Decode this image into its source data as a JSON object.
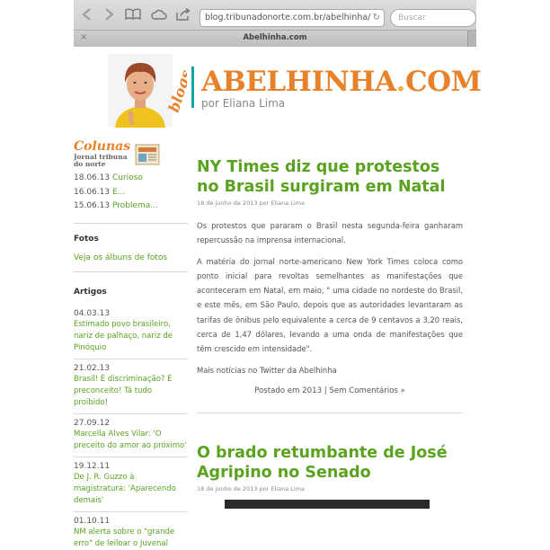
{
  "browser": {
    "url": "blog.tribunadonorte.com.br/abelhinha/",
    "search_placeholder": "Buscar",
    "tab_title": "Abelhinha.com",
    "tab_close": "×",
    "icons": [
      "back-icon",
      "forward-icon",
      "bookmarks-icon",
      "cloud-icon",
      "share-icon",
      "reload-icon"
    ]
  },
  "header": {
    "blogs_tag": "blogs",
    "title_main": "ABELHINHA",
    "title_dot": ".",
    "title_tld": "COM",
    "byline": "por Eliana Lima",
    "colors": {
      "title": "#e8822a",
      "divider": "#16a5a5"
    }
  },
  "sidebar": {
    "colunas": {
      "logo_title": "Colunas",
      "logo_subtitle": "Jornal tribuna do norte",
      "items": [
        {
          "date": "18.06.13",
          "label": "Curioso"
        },
        {
          "date": "16.06.13",
          "label": "E..."
        },
        {
          "date": "15.06.13",
          "label": "Problema..."
        }
      ]
    },
    "fotos": {
      "heading": "Fotos",
      "link": "Veja os álbuns de fotos"
    },
    "artigos": {
      "heading": "Artigos",
      "items": [
        {
          "date": "04.03.13",
          "title": "Estimado povo brasileiro, nariz de palhaço, nariz de Pinóquio"
        },
        {
          "date": "21.02.13",
          "title": "Brasil! É discriminação? É preconceito! Tá tudo proibido!"
        },
        {
          "date": "27.09.12",
          "title": "Marcella Alves Vilar: 'O preceito do amor ao próximo'"
        },
        {
          "date": "19.12.11",
          "title": "De J. R. Guzzo à magistratura: 'Aparecendo demais'"
        },
        {
          "date": "01.10.11",
          "title": "NM alerta sobre o \"grande erro\" de leiloar o Juvenal Lamartine"
        }
      ]
    },
    "link_color": "#5aa21f"
  },
  "posts": [
    {
      "title": "NY Times diz que protestos no Brasil surgiram em Natal",
      "meta": "18 de junho de 2013 por Eliana Lima",
      "paragraphs": [
        "Os protestos que pararam o Brasil nesta segunda-feira ganharam repercussão na imprensa internacional.",
        "A matéria do jornal norte-americano New York Times coloca como ponto inicial para revoltas semelhantes as manifestações que aconteceram em Natal, em maio, \" uma cidade no nordeste do Brasil, e este mês, em São Paulo, depois que as autoridades levantaram as tarifas de ônibus pelo equivalente a cerca de 9 centavos a 3,20 reais, cerca de 1,47 dólares, levando a uma onda de manifestações que têm crescido em intensidade\".",
        "Mais notícias no Twitter da Abelhinha"
      ],
      "footer": "Postado em 2013 | Sem Comentários »"
    },
    {
      "title": "O brado retumbante de José Agripino no Senado",
      "meta": "18 de junho de 2013 por Eliana Lima"
    }
  ]
}
